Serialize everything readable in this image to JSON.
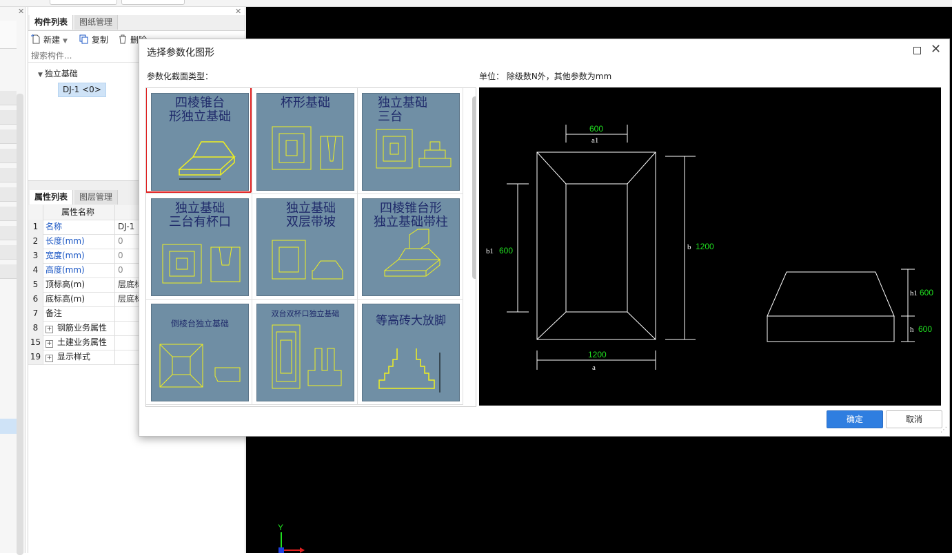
{
  "dialog": {
    "title": "选择参数化图形",
    "section_label": "参数化截面类型：",
    "unit_label": "单位：  除级数N外，其他参数为mm",
    "ok_label": "确定",
    "cancel_label": "取消",
    "shapes": [
      {
        "caption": "四棱锥台\n形独立基础",
        "selected": true
      },
      {
        "caption": "杯形基础",
        "selected": false
      },
      {
        "caption": "独立基础\n三台",
        "selected": false
      },
      {
        "caption": "独立基础\n三台有杯口",
        "selected": false
      },
      {
        "caption": "独立基础\n双层带坡",
        "selected": false
      },
      {
        "caption": "四棱锥台形\n独立基础带柱",
        "selected": false
      },
      {
        "caption": "倒棱台独立基础",
        "selected": false
      },
      {
        "caption": "双台双杯口独立基础",
        "selected": false
      },
      {
        "caption": "等高砖大放脚",
        "selected": false
      }
    ],
    "preview": {
      "a1_value": "600",
      "a1_label": "a1",
      "b1_value": "600",
      "b1_label": "b1",
      "b_value": "1200",
      "b_label": "b",
      "a_value": "1200",
      "a_label": "a",
      "h1_value": "600",
      "h1_label": "h1",
      "h_value": "600",
      "h_label": "h"
    }
  },
  "component_panel": {
    "tabs": [
      "构件列表",
      "图纸管理"
    ],
    "toolbar": {
      "new_label": "新建",
      "copy_label": "复制",
      "delete_label": "删除"
    },
    "search_placeholder": "搜索构件...",
    "tree_root": "独立基础",
    "tree_child": "DJ-1 <0>"
  },
  "property_panel": {
    "tabs": [
      "属性列表",
      "图层管理"
    ],
    "header_name": "属性名称",
    "rows": [
      {
        "num": "1",
        "name": "名称",
        "value": "DJ-1"
      },
      {
        "num": "2",
        "name": "长度(mm)",
        "value": "0"
      },
      {
        "num": "3",
        "name": "宽度(mm)",
        "value": "0"
      },
      {
        "num": "4",
        "name": "高度(mm)",
        "value": "0"
      },
      {
        "num": "5",
        "name": "顶标高(m)",
        "value": "层底标"
      },
      {
        "num": "6",
        "name": "底标高(m)",
        "value": "层底标"
      },
      {
        "num": "7",
        "name": "备注",
        "value": ""
      },
      {
        "num": "8",
        "name": "钢筋业务属性",
        "value": ""
      },
      {
        "num": "15",
        "name": "土建业务属性",
        "value": ""
      },
      {
        "num": "19",
        "name": "显示样式",
        "value": ""
      }
    ]
  },
  "axis": {
    "y_label": "Y"
  },
  "colors": {
    "accent": "#2f7ee0",
    "selection": "#e02020",
    "thumb_bg": "#708fa5",
    "dim_green": "#20e020",
    "canvas": "#000000"
  }
}
